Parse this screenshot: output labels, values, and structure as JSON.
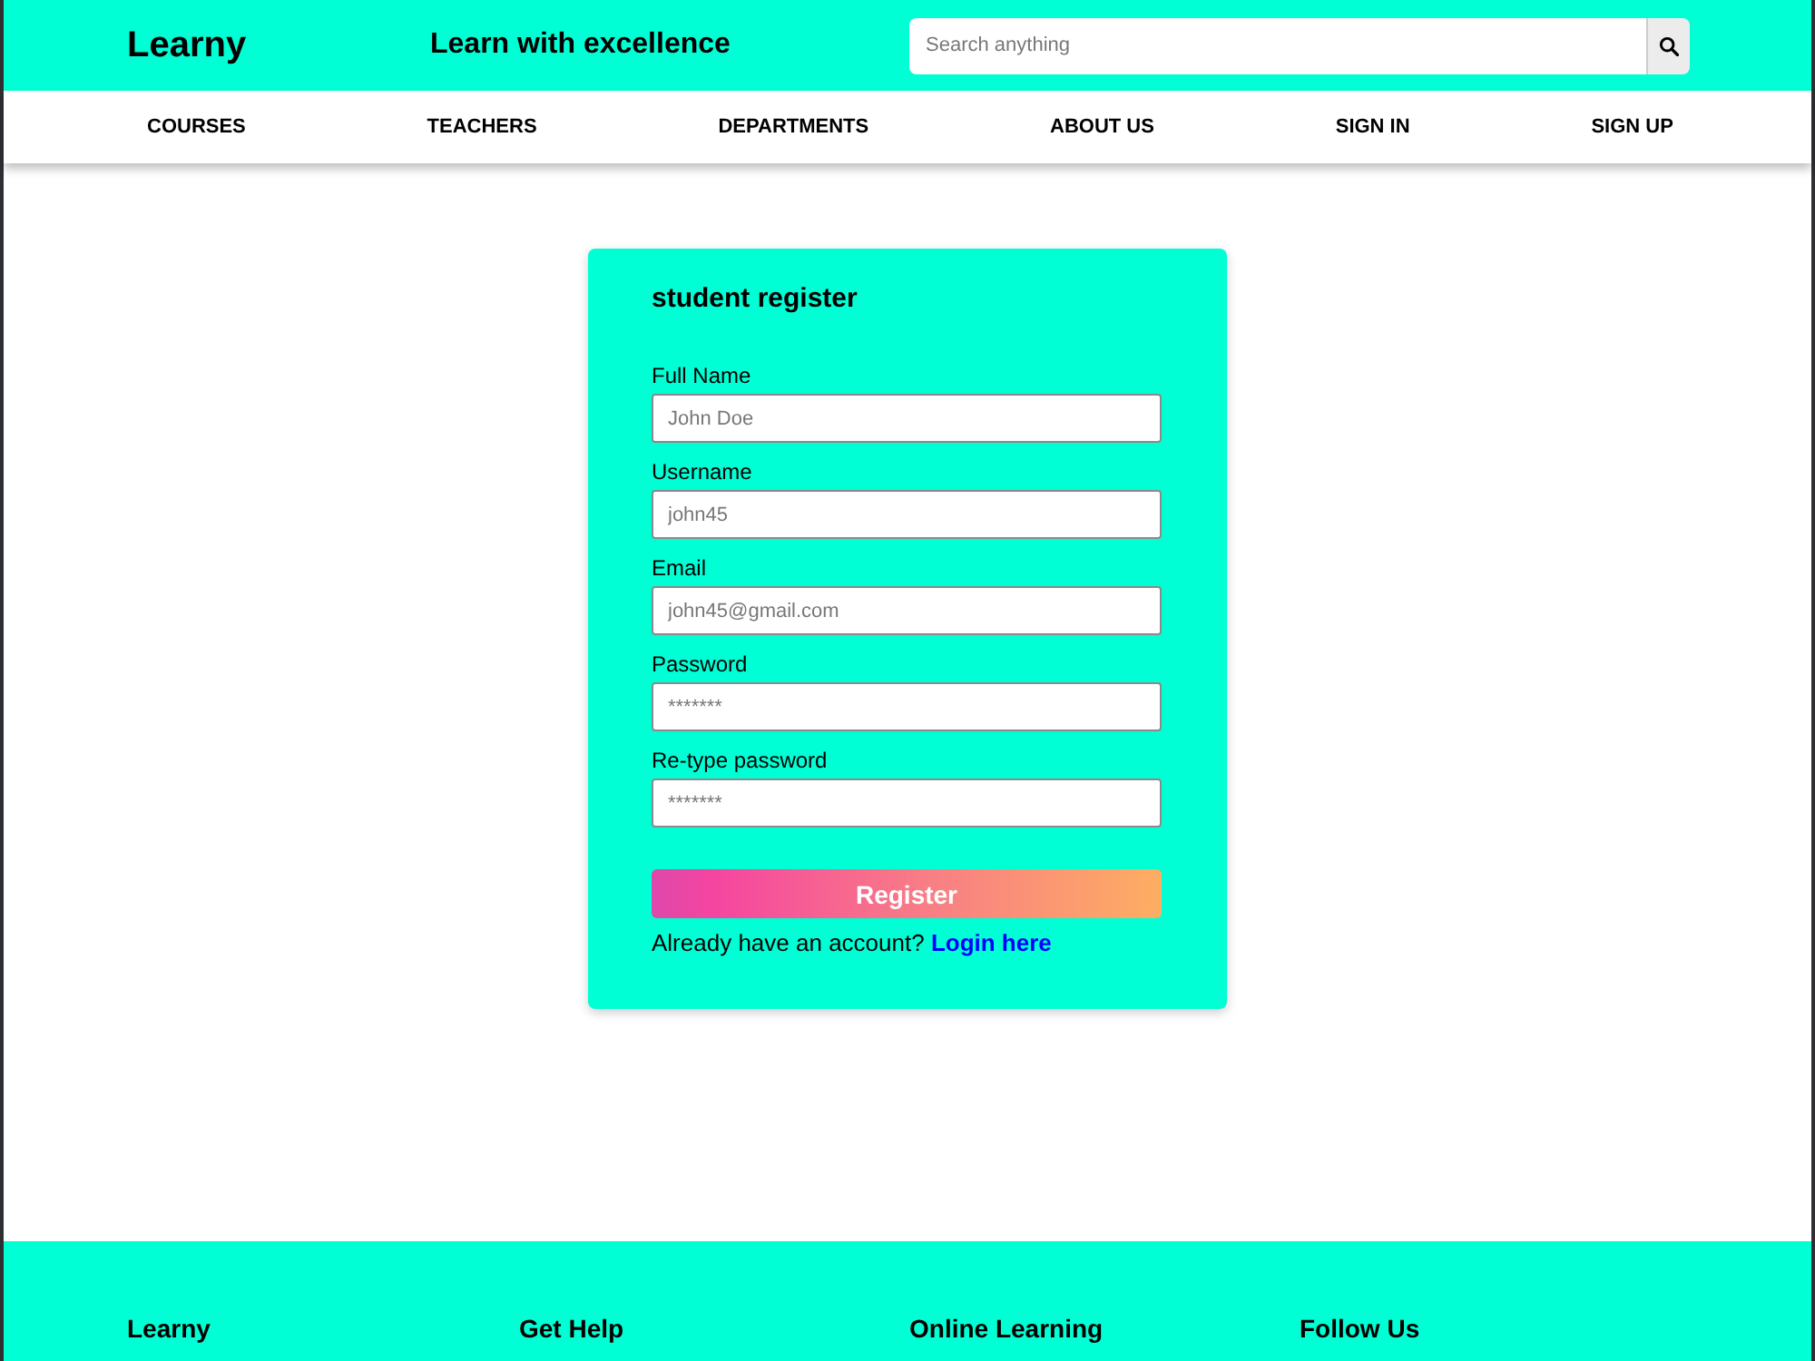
{
  "header": {
    "logo": "Learny",
    "tagline": "Learn with excellence",
    "search": {
      "placeholder": "Search anything"
    }
  },
  "nav": [
    "COURSES",
    "TEACHERS",
    "DEPARTMENTS",
    "ABOUT US",
    "SIGN IN",
    "SIGN UP"
  ],
  "form": {
    "title": "student register",
    "fields": [
      {
        "label": "Full Name",
        "placeholder": "John Doe"
      },
      {
        "label": "Username",
        "placeholder": "john45"
      },
      {
        "label": "Email",
        "placeholder": "john45@gmail.com"
      },
      {
        "label": "Password",
        "placeholder": "*******"
      },
      {
        "label": "Re-type password",
        "placeholder": "*******"
      }
    ],
    "submit": "Register",
    "prompt": "Already have an account?",
    "link": "Login here"
  },
  "footer": {
    "headings": [
      "Learny",
      "Get Help",
      "Online Learning",
      "Follow Us"
    ]
  }
}
